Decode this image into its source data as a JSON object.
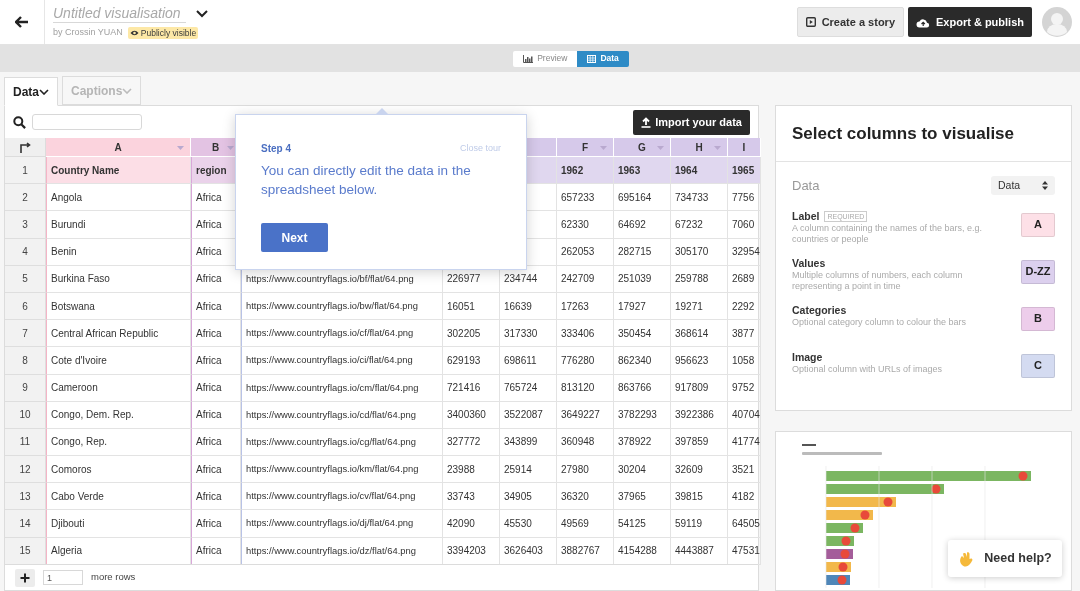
{
  "header": {
    "title": "Untitled visualisation",
    "byline": "by Crossin YUAN",
    "visibility_badge": "Publicly visible",
    "buttons": [
      {
        "label": "Create a story",
        "kind": "secondary"
      },
      {
        "label": "Export & publish",
        "kind": "primary"
      }
    ]
  },
  "view_toggle": [
    {
      "label": "Preview",
      "selected": false
    },
    {
      "label": "Data",
      "selected": true
    }
  ],
  "panel_tabs": [
    {
      "label": "Data",
      "selected": true
    },
    {
      "label": "Captions",
      "selected": false
    }
  ],
  "import_button": "Import your data",
  "table": {
    "columns": [
      {
        "letter": "A",
        "color": "#fbd3dd"
      },
      {
        "letter": "B",
        "color": "#e3c3e3"
      },
      {},
      {},
      {
        "color": "#d6c9ea"
      },
      {
        "letter": "F",
        "color": "#d6c9ea"
      },
      {
        "letter": "G",
        "color": "#d6c9ea"
      },
      {
        "letter": "H",
        "color": "#d6c9ea"
      },
      {
        "letter": "I",
        "color": "#d6c9ea"
      }
    ],
    "rows": [
      {
        "number": "1",
        "cells": [
          "Country Name",
          "region",
          null,
          null,
          null,
          "1962",
          "1963",
          "1964",
          "1965"
        ]
      },
      {
        "number": "2",
        "cells": [
          "Angola",
          "Africa",
          null,
          null,
          null,
          "657233",
          "695164",
          "734733",
          "7756"
        ]
      },
      {
        "number": "3",
        "cells": [
          "Burundi",
          "Africa",
          null,
          null,
          null,
          "62330",
          "64692",
          "67232",
          "7060"
        ]
      },
      {
        "number": "4",
        "cells": [
          "Benin",
          "Africa",
          null,
          null,
          null,
          "262053",
          "282715",
          "305170",
          "32954"
        ]
      },
      {
        "number": "5",
        "cells": [
          "Burkina Faso",
          "Africa",
          "https://www.countryflags.io/bf/flat/64.png",
          "226977",
          "234744",
          "242709",
          "251039",
          "259788",
          "2689"
        ]
      },
      {
        "number": "6",
        "cells": [
          "Botswana",
          "Africa",
          "https://www.countryflags.io/bw/flat/64.png",
          "16051",
          "16639",
          "17263",
          "17927",
          "19271",
          "2292"
        ]
      },
      {
        "number": "7",
        "cells": [
          "Central African Republic",
          "Africa",
          "https://www.countryflags.io/cf/flat/64.png",
          "302205",
          "317330",
          "333406",
          "350454",
          "368614",
          "3877"
        ]
      },
      {
        "number": "8",
        "cells": [
          "Cote d'Ivoire",
          "Africa",
          "https://www.countryflags.io/ci/flat/64.png",
          "629193",
          "698611",
          "776280",
          "862340",
          "956623",
          "1058"
        ]
      },
      {
        "number": "9",
        "cells": [
          "Cameroon",
          "Africa",
          "https://www.countryflags.io/cm/flat/64.png",
          "721416",
          "765724",
          "813120",
          "863766",
          "917809",
          "9752"
        ]
      },
      {
        "number": "10",
        "cells": [
          "Congo, Dem. Rep.",
          "Africa",
          "https://www.countryflags.io/cd/flat/64.png",
          "3400360",
          "3522087",
          "3649227",
          "3782293",
          "3922386",
          "40704"
        ]
      },
      {
        "number": "11",
        "cells": [
          "Congo, Rep.",
          "Africa",
          "https://www.countryflags.io/cg/flat/64.png",
          "327772",
          "343899",
          "360948",
          "378922",
          "397859",
          "41774"
        ]
      },
      {
        "number": "12",
        "cells": [
          "Comoros",
          "Africa",
          "https://www.countryflags.io/km/flat/64.png",
          "23988",
          "25914",
          "27980",
          "30204",
          "32609",
          "3521"
        ]
      },
      {
        "number": "13",
        "cells": [
          "Cabo Verde",
          "Africa",
          "https://www.countryflags.io/cv/flat/64.png",
          "33743",
          "34905",
          "36320",
          "37965",
          "39815",
          "4182"
        ]
      },
      {
        "number": "14",
        "cells": [
          "Djibouti",
          "Africa",
          "https://www.countryflags.io/dj/flat/64.png",
          "42090",
          "45530",
          "49569",
          "54125",
          "59119",
          "64505"
        ]
      },
      {
        "number": "15",
        "cells": [
          "Algeria",
          "Africa",
          "https://www.countryflags.io/dz/flat/64.png",
          "3394203",
          "3626403",
          "3882767",
          "4154288",
          "4443887",
          "47531"
        ]
      }
    ]
  },
  "add_rows": {
    "count": "1",
    "label": "more rows"
  },
  "tour": {
    "step": "Step 4",
    "close": "Close tour",
    "message": "You can directly edit the data in the spreadsheet below.",
    "button": "Next"
  },
  "column_selector": {
    "title": "Select columns to visualise",
    "sheet_label": "Data",
    "sheet_select": "Data",
    "bindings": [
      {
        "name": "Label",
        "required_badge": "REQUIRED",
        "description": "A column containing the names of the bars, e.g. countries or people",
        "columns": "A",
        "color": "#fde0e7"
      },
      {
        "name": "Values",
        "description": "Multiple columns of numbers, each column representing a point in time",
        "columns": "D-ZZ",
        "color": "#dcd0ee"
      },
      {
        "name": "Categories",
        "description": "Optional category column to colour the bars",
        "columns": "B",
        "color": "#edcdeb"
      },
      {
        "name": "Image",
        "description": "Optional column with URLs of images",
        "columns": "C",
        "color": "#d4dbf1"
      }
    ]
  },
  "help_button": "Need help?"
}
